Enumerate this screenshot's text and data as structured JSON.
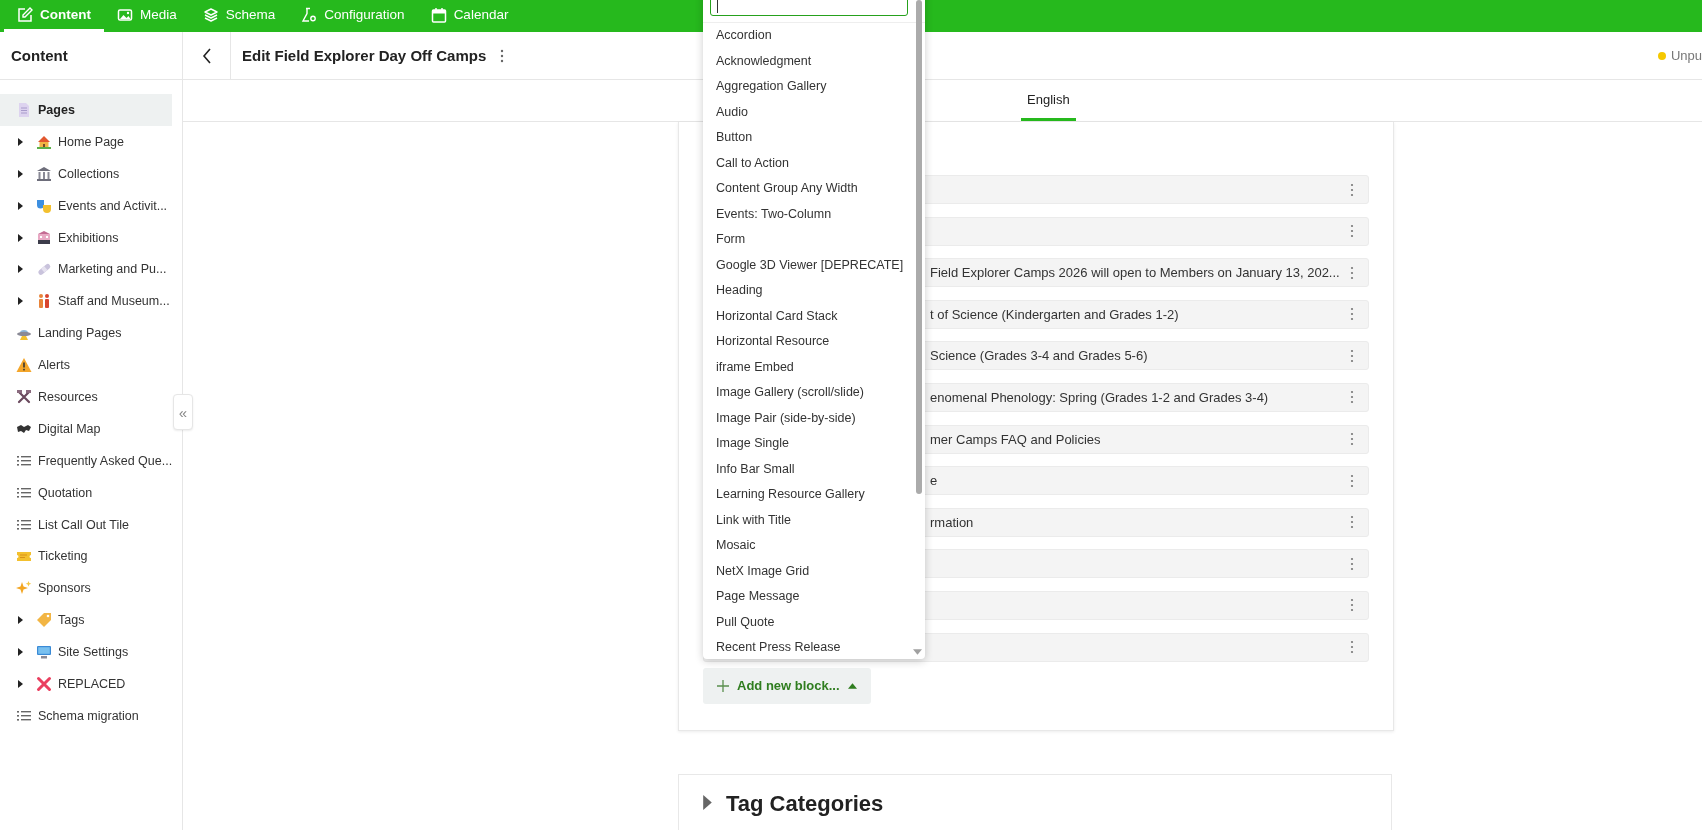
{
  "nav_tabs": [
    {
      "label": "Content",
      "selected": true
    },
    {
      "label": "Media",
      "selected": false
    },
    {
      "label": "Schema",
      "selected": false
    },
    {
      "label": "Configuration",
      "selected": false
    },
    {
      "label": "Calendar",
      "selected": false
    }
  ],
  "sidebar": {
    "title": "Content",
    "collapse_toggle": "«",
    "items": [
      {
        "label": "Pages",
        "kind": "link",
        "selected": true
      },
      {
        "label": "Home Page",
        "kind": "group",
        "expanded": false,
        "selected": false
      },
      {
        "label": "Collections",
        "kind": "group",
        "expanded": false,
        "selected": false
      },
      {
        "label": "Events and Activit...",
        "kind": "group",
        "expanded": false,
        "selected": false
      },
      {
        "label": "Exhibitions",
        "kind": "group",
        "expanded": false,
        "selected": false
      },
      {
        "label": "Marketing and Pu...",
        "kind": "group",
        "expanded": false,
        "selected": false
      },
      {
        "label": "Staff and Museum...",
        "kind": "group",
        "expanded": false,
        "selected": false
      },
      {
        "label": "Landing Pages",
        "kind": "link",
        "selected": false
      },
      {
        "label": "Alerts",
        "kind": "link",
        "selected": false
      },
      {
        "label": "Resources",
        "kind": "link",
        "selected": false
      },
      {
        "label": "Digital Map",
        "kind": "link",
        "selected": false
      },
      {
        "label": "Frequently Asked Que...",
        "kind": "link",
        "selected": false
      },
      {
        "label": "Quotation",
        "kind": "link",
        "selected": false
      },
      {
        "label": "List Call Out Tile",
        "kind": "link",
        "selected": false
      },
      {
        "label": "Ticketing",
        "kind": "link",
        "selected": false
      },
      {
        "label": "Sponsors",
        "kind": "link",
        "selected": false
      },
      {
        "label": "Tags",
        "kind": "group",
        "expanded": false,
        "selected": false
      },
      {
        "label": "Site Settings",
        "kind": "group",
        "expanded": false,
        "selected": false
      },
      {
        "label": "REPLACED",
        "kind": "group",
        "expanded": false,
        "selected": false
      },
      {
        "label": "Schema migration",
        "kind": "link",
        "selected": false
      }
    ]
  },
  "header": {
    "title": "Edit Field Explorer Day Off Camps",
    "status": "Unpu"
  },
  "locale_tabs": [
    {
      "label": "English",
      "selected": true
    }
  ],
  "blocks": [
    {
      "kind": "block"
    },
    {
      "kind": "block"
    },
    {
      "kind": "block",
      "text": "Field Explorer Camps 2026 will open to Members on January 13, 202..."
    },
    {
      "kind": "block",
      "text": "t of Science (Kindergarten and Grades 1-2)"
    },
    {
      "kind": "block",
      "text": "Science (Grades 3-4 and Grades 5-6)"
    },
    {
      "kind": "block",
      "text": "enomenal Phenology: Spring (Grades 1-2 and Grades 3-4)"
    },
    {
      "kind": "block",
      "text": "mer Camps FAQ and Policies"
    },
    {
      "kind": "block",
      "text": "e"
    },
    {
      "kind": "block",
      "text": "rmation"
    },
    {
      "kind": "block"
    },
    {
      "kind": "block"
    },
    {
      "kind": "block"
    }
  ],
  "block_picker": {
    "items": [
      "Accordion",
      "Acknowledgment",
      "Aggregation Gallery",
      "Audio",
      "Button",
      "Call to Action",
      "Content Group Any Width",
      "Events: Two-Column",
      "Form",
      "Google 3D Viewer [DEPRECATE]",
      "Heading",
      "Horizontal Card Stack",
      "Horizontal Resource",
      "iframe Embed",
      "Image Gallery (scroll/slide)",
      "Image Pair (side-by-side)",
      "Image Single",
      "Info Bar Small",
      "Learning Resource Gallery",
      "Link with Title",
      "Mosaic",
      "NetX Image Grid",
      "Page Message",
      "Pull Quote",
      "Recent Press Release"
    ]
  },
  "add_block_button": "Add new block...",
  "tag_categories": {
    "title": "Tag Categories",
    "expanded": false
  }
}
